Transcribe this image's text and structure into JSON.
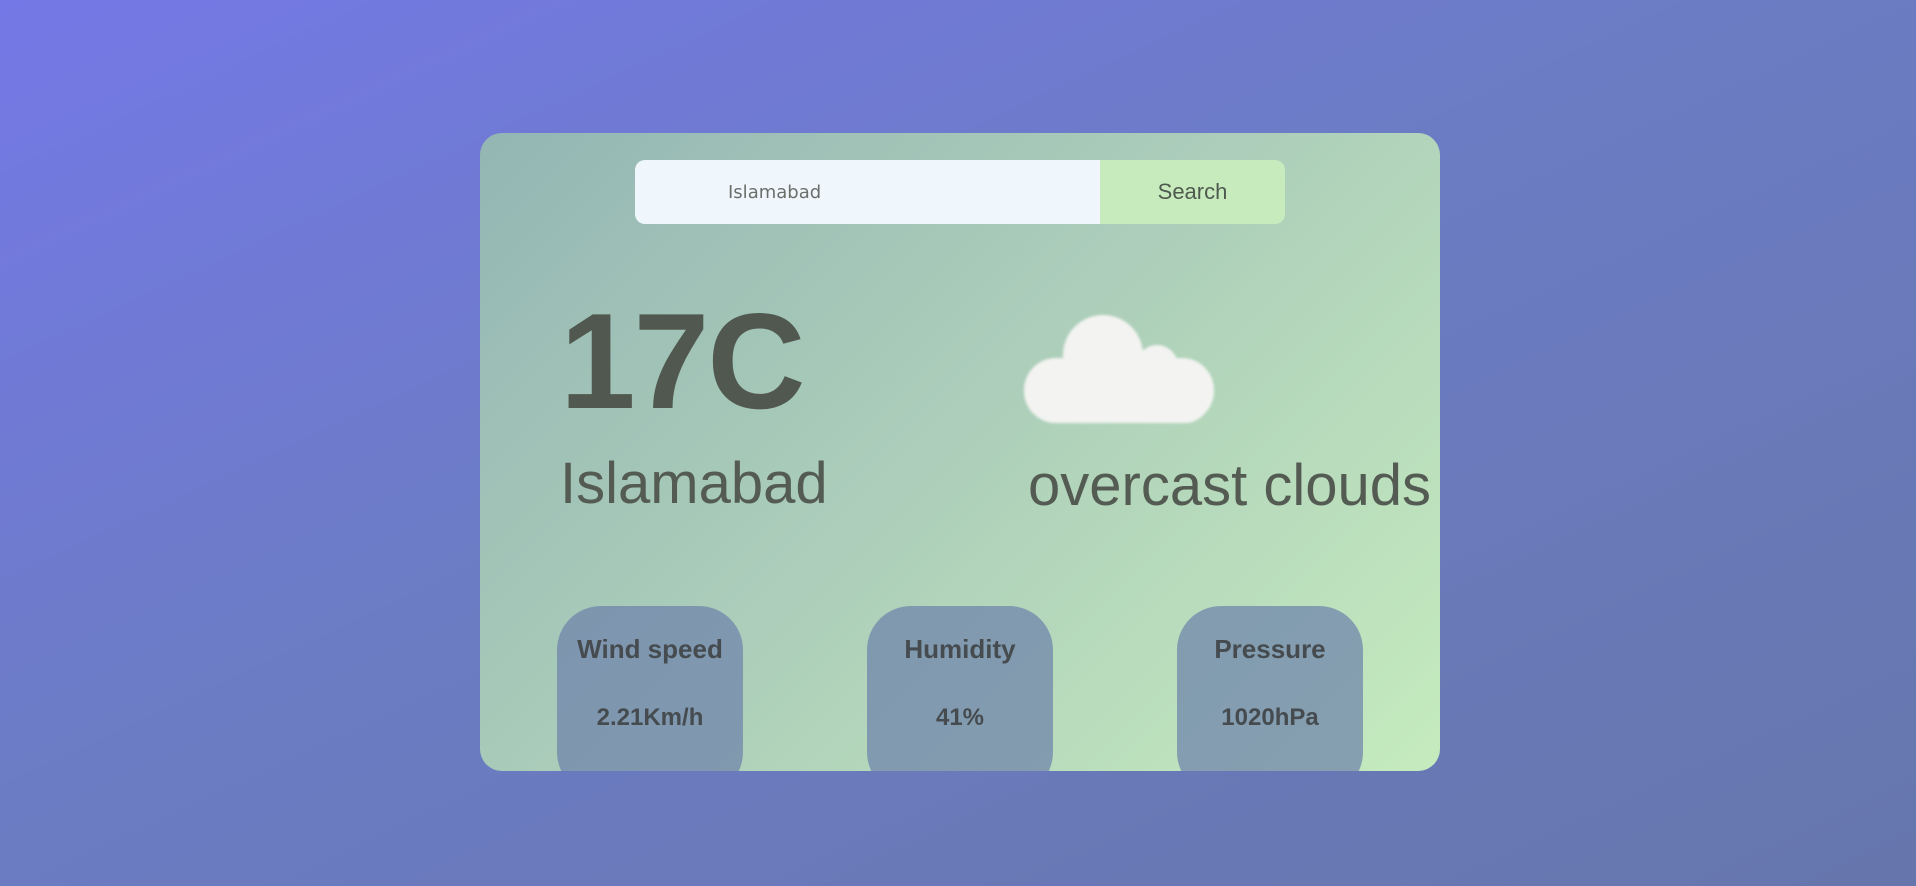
{
  "search": {
    "placeholder": "Islamabad",
    "button_label": "Search"
  },
  "weather": {
    "temperature": "17C",
    "city": "Islamabad",
    "description": "overcast clouds",
    "icon": "cloud-icon"
  },
  "stats": [
    {
      "label": "Wind speed",
      "value": "2.21Km/h"
    },
    {
      "label": "Humidity",
      "value": "41%"
    },
    {
      "label": "Pressure",
      "value": "1020hPa"
    }
  ]
}
